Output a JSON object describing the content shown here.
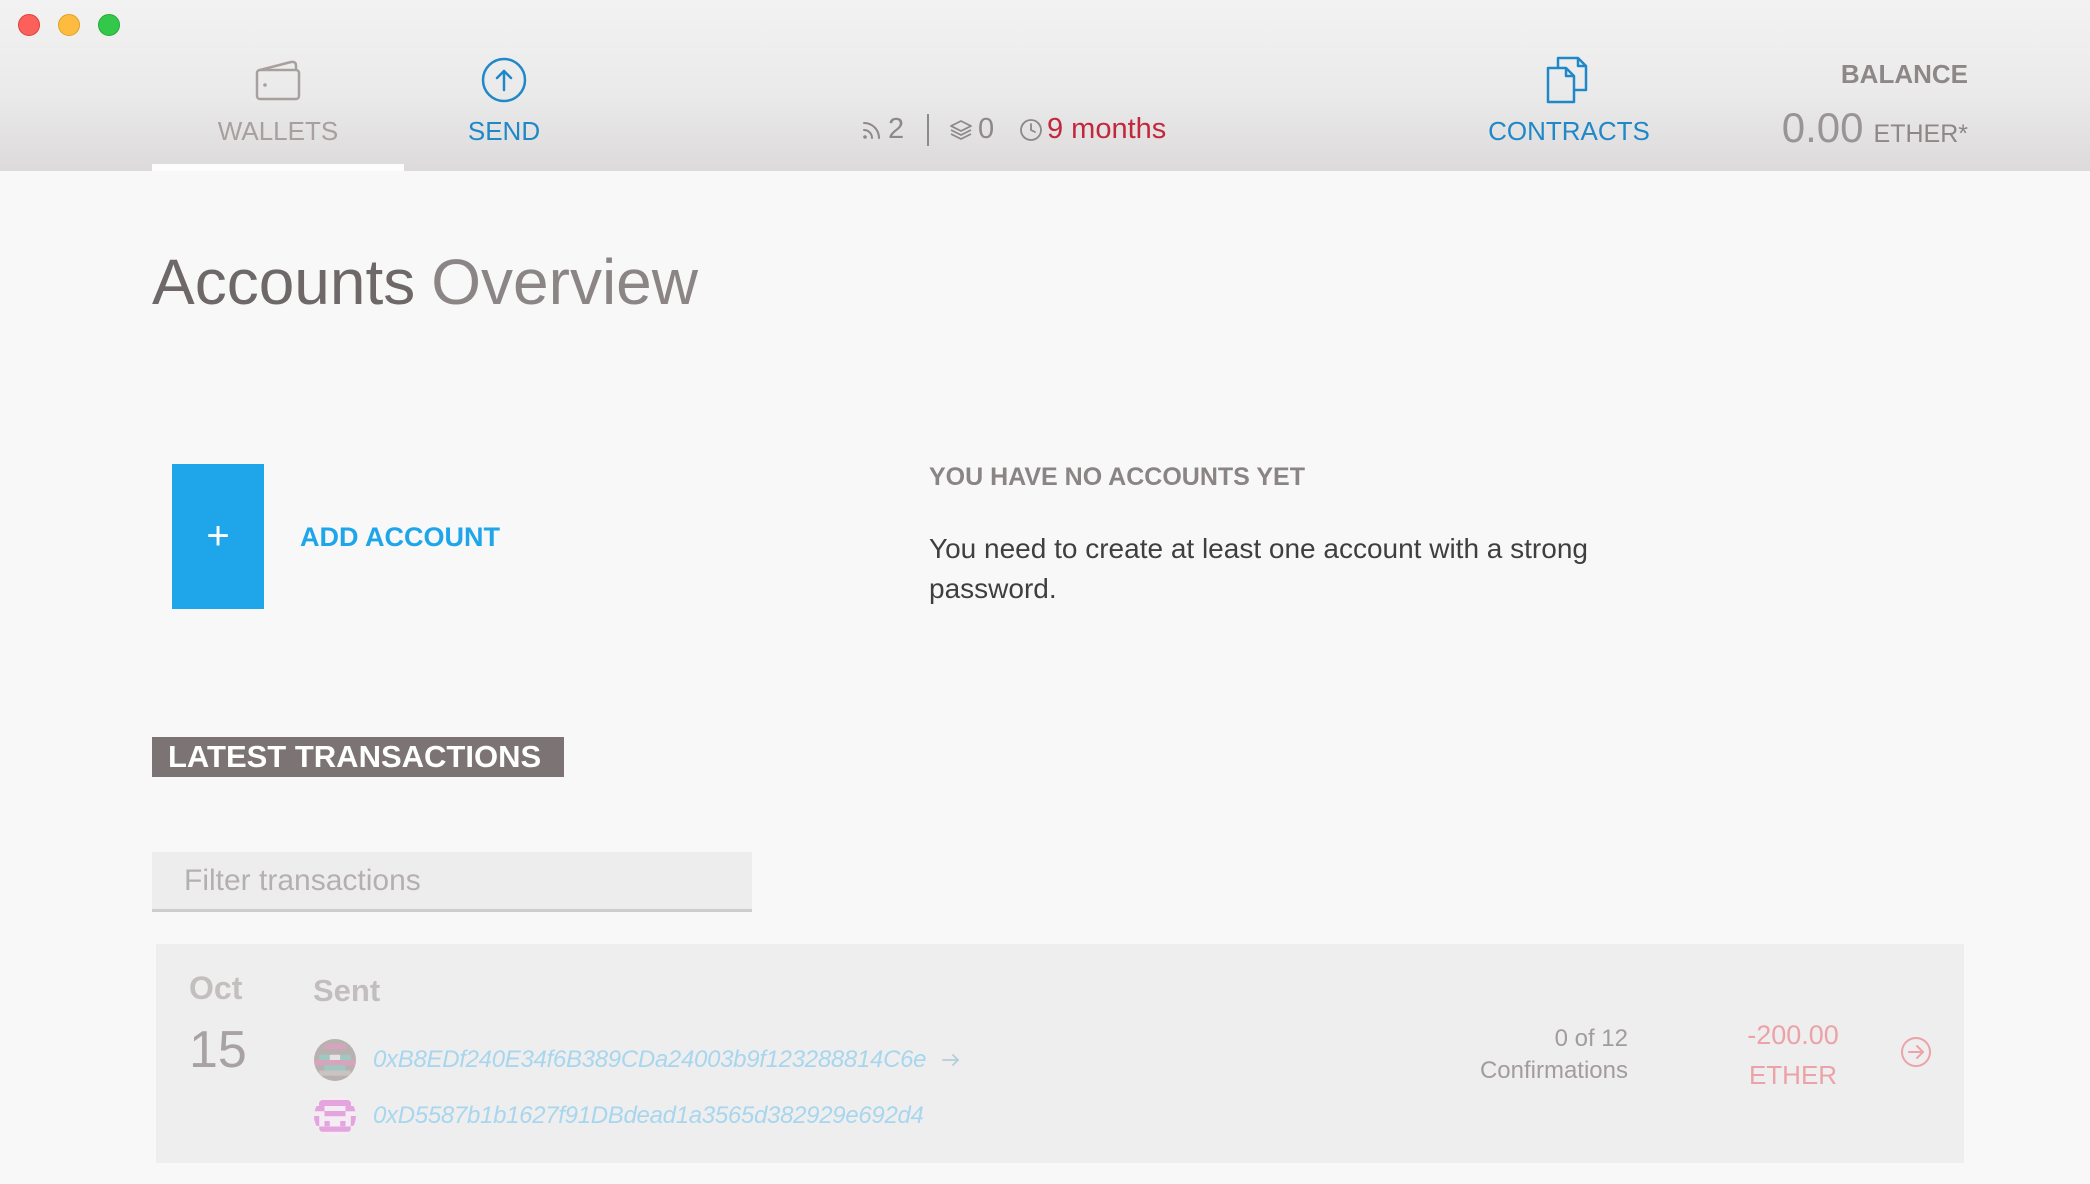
{
  "nav": {
    "wallets": {
      "label": "WALLETS",
      "icon": "wallet-icon",
      "active": true
    },
    "send": {
      "label": "SEND",
      "icon": "send-icon"
    },
    "contracts": {
      "label": "CONTRACTS",
      "icon": "contracts-icon"
    }
  },
  "status": {
    "peers": "2",
    "peers_icon": "peers-icon",
    "blocks": "0",
    "blocks_icon": "layers-icon",
    "last_block": "9 months",
    "last_block_icon": "clock-icon"
  },
  "balance": {
    "label": "BALANCE",
    "amount": "0.00",
    "unit": "ETHER*"
  },
  "page": {
    "title_strong": "Accounts",
    "title_light": "Overview"
  },
  "add_account": {
    "symbol": "+",
    "label": "ADD ACCOUNT"
  },
  "empty_state": {
    "heading": "YOU HAVE NO ACCOUNTS YET",
    "message": "You need to create at least one account with a strong password."
  },
  "transactions": {
    "heading": "LATEST TRANSACTIONS",
    "filter": {
      "placeholder": "Filter transactions",
      "value": ""
    },
    "items": [
      {
        "month": "Oct",
        "day": "15",
        "type": "Sent",
        "from": "0xB8EDf240E34f6B389CDa24003b9f123288814C6e",
        "to": "0xD5587b1b1627f91DBdead1a3565d382929e692d4",
        "confirmations": "0 of 12",
        "confirmations_label": "Confirmations",
        "amount": "-200.00",
        "unit": "ETHER",
        "open_icon": "circle-arrow-right-icon"
      }
    ]
  },
  "colors": {
    "accent": "#1e88c8",
    "add_account": "#1ea5ea",
    "sync_warning": "#c3273c",
    "pending_amount": "#eba2a8",
    "address_link": "#a7d6ef",
    "inactive_nav": "#a89f9f",
    "header_top": "#f3f2f2",
    "header_bottom": "#dcdada",
    "latest_transactions_bg": "#7c7474",
    "window_close": "#fc605b",
    "window_minimize": "#fdbc40",
    "window_maximize": "#34c84a"
  }
}
